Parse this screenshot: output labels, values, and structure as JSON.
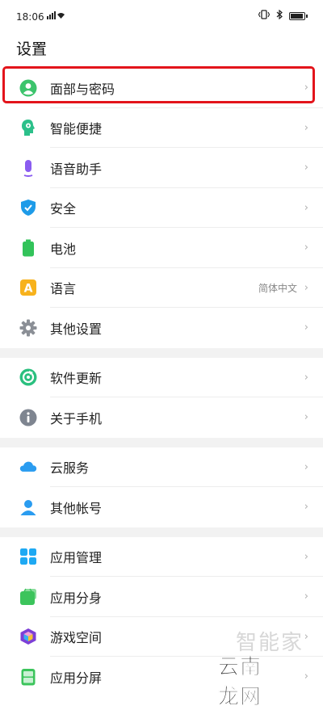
{
  "status_bar": {
    "time": "18:06",
    "signal": "ıl",
    "wifi_icon": "wifi-icon",
    "vibrate_icon": "vibrate-icon",
    "bluetooth_icon": "bluetooth-icon",
    "battery_icon": "battery-icon"
  },
  "page_title": "设置",
  "highlight_color": "#e3141b",
  "groups": [
    {
      "items": [
        {
          "label": "面部与密码",
          "icon": "face-id-icon",
          "color": "#3cc46c"
        },
        {
          "label": "智能便捷",
          "icon": "smart-assist-icon",
          "color": "#2cc08a"
        },
        {
          "label": "语音助手",
          "icon": "microphone-icon",
          "color": "#8a5cf0"
        },
        {
          "label": "安全",
          "icon": "shield-icon",
          "color": "#1e9be8"
        },
        {
          "label": "电池",
          "icon": "battery-settings-icon",
          "color": "#32c35a"
        },
        {
          "label": "语言",
          "value": "简体中文",
          "icon": "language-icon",
          "color": "#f7b21c"
        },
        {
          "label": "其他设置",
          "icon": "gear-icon",
          "color": "#8b8f96"
        }
      ]
    },
    {
      "items": [
        {
          "label": "软件更新",
          "icon": "update-icon",
          "color": "#2bc07f"
        },
        {
          "label": "关于手机",
          "icon": "info-icon",
          "color": "#7e8590"
        }
      ]
    },
    {
      "items": [
        {
          "label": "云服务",
          "icon": "cloud-icon",
          "color": "#2a9cf0"
        },
        {
          "label": "其他帐号",
          "icon": "person-icon",
          "color": "#2a9cf0"
        }
      ]
    },
    {
      "items": [
        {
          "label": "应用管理",
          "icon": "app-grid-icon",
          "color": "#1ea9f3"
        },
        {
          "label": "应用分身",
          "icon": "app-clone-icon",
          "color": "#3cc45c"
        },
        {
          "label": "游戏空间",
          "icon": "game-space-icon",
          "color": "#7d3fd6"
        },
        {
          "label": "应用分屏",
          "icon": "split-screen-icon",
          "color": "#3cc45c"
        }
      ]
    }
  ],
  "watermark": {
    "top": "智能家",
    "bottom": "云南龙网"
  }
}
